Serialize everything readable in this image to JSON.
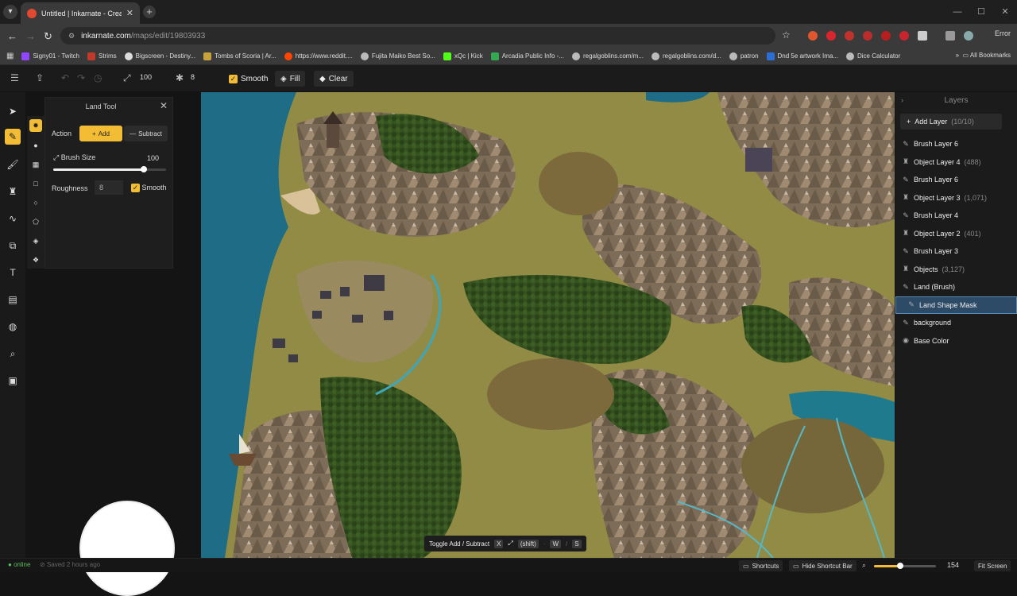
{
  "browser": {
    "tab_title": "Untitled | Inkarnate - Create Fa",
    "url_host": "inkarnate.com",
    "url_path": "/maps/edit/19803933",
    "error_label": "Error",
    "bookmarks": [
      "Signy01 - Twitch",
      "Strims",
      "Bigscreen - Destiny...",
      "Tombs of Scoria | Ar...",
      "https://www.reddit....",
      "Fujita Maiko Best So...",
      "xQc | Kick",
      "Arcadia Public Info -...",
      "regalgoblins.com/m...",
      "regalgoblins.com/d...",
      "patron",
      "Dnd 5e artwork Ima...",
      "Dice Calculator"
    ],
    "all_bookmarks": "All Bookmarks"
  },
  "toolbar": {
    "size_value": "100",
    "roughness_value": "8",
    "smooth_label": "Smooth",
    "fill_label": "Fill",
    "clear_label": "Clear"
  },
  "tool_panel": {
    "title": "Land Tool",
    "action_label": "Action",
    "add_label": "Add",
    "subtract_label": "Subtract",
    "brush_size_label": "Brush Size",
    "brush_size_value": "100",
    "brush_size_fraction": 0.8,
    "roughness_label": "Roughness",
    "roughness_value": "8",
    "smooth_label": "Smooth"
  },
  "layers": {
    "title": "Layers",
    "add_layer_label": "Add Layer",
    "add_layer_count": "(10/10)",
    "items": [
      {
        "label": "Brush Layer 6",
        "count": "",
        "icon": "brush"
      },
      {
        "label": "Object Layer 4",
        "count": "(488)",
        "icon": "object"
      },
      {
        "label": "Brush Layer 6",
        "count": "",
        "icon": "brush"
      },
      {
        "label": "Object Layer 3",
        "count": "(1,071)",
        "icon": "object"
      },
      {
        "label": "Brush Layer 4",
        "count": "",
        "icon": "brush"
      },
      {
        "label": "Object Layer 2",
        "count": "(401)",
        "icon": "object"
      },
      {
        "label": "Brush Layer 3",
        "count": "",
        "icon": "brush"
      },
      {
        "label": "Objects",
        "count": "(3,127)",
        "icon": "object"
      },
      {
        "label": "Land (Brush)",
        "count": "",
        "icon": "brush"
      },
      {
        "label": "Land Shape Mask",
        "count": "",
        "icon": "brush",
        "selected": true
      },
      {
        "label": "background",
        "count": "",
        "icon": "brush"
      },
      {
        "label": "Base Color",
        "count": "",
        "icon": "palette"
      }
    ]
  },
  "hint": {
    "label": "Toggle Add / Subtract",
    "key1": "X",
    "key2": "(shift)",
    "key3": "W",
    "key4": "S"
  },
  "status": {
    "online": "online",
    "saved": "Saved 2 hours ago",
    "shortcuts": "Shortcuts",
    "hide_shortcut_bar": "Hide Shortcut Bar",
    "zoom_value": "154",
    "zoom_fraction": 0.42,
    "fit_screen": "Fit Screen"
  },
  "colors": {
    "accent": "#f2bc34",
    "selected_layer": "#2d4a66",
    "water": "#1f6c86",
    "grass": "#8f8a45",
    "forest": "#2f4a1e",
    "mountain": "#7a6a58"
  }
}
